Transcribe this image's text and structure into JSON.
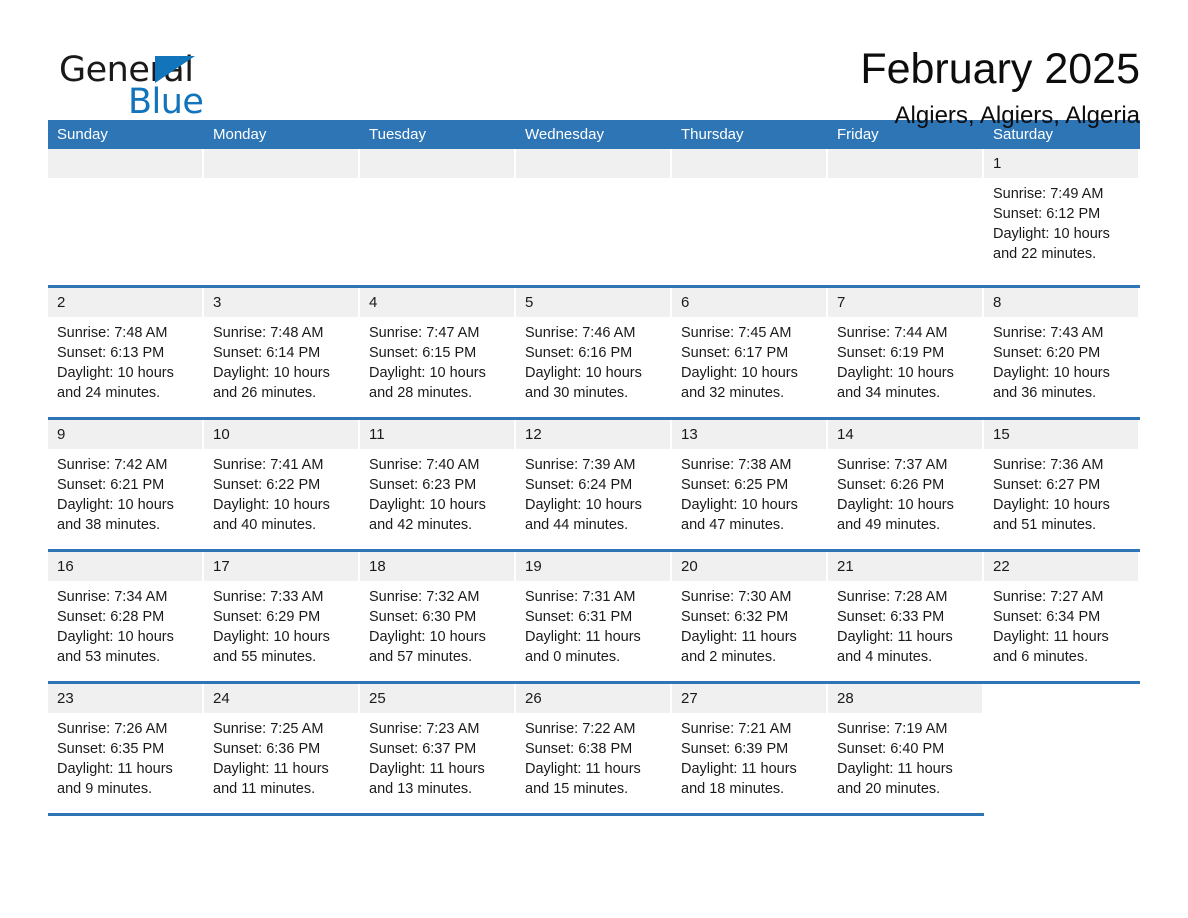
{
  "brand": {
    "name_part1": "General",
    "name_part2": "Blue",
    "triangle_color": "#1274bb",
    "accent_color": "#2e75b6"
  },
  "header": {
    "title": "February 2025",
    "location": "Algiers, Algiers, Algeria"
  },
  "calendar": {
    "weekdays": [
      "Sunday",
      "Monday",
      "Tuesday",
      "Wednesday",
      "Thursday",
      "Friday",
      "Saturday"
    ],
    "weeks": [
      [
        {
          "date": "",
          "sunrise": "",
          "sunset": "",
          "daylight_line1": "",
          "daylight_line2": ""
        },
        {
          "date": "",
          "sunrise": "",
          "sunset": "",
          "daylight_line1": "",
          "daylight_line2": ""
        },
        {
          "date": "",
          "sunrise": "",
          "sunset": "",
          "daylight_line1": "",
          "daylight_line2": ""
        },
        {
          "date": "",
          "sunrise": "",
          "sunset": "",
          "daylight_line1": "",
          "daylight_line2": ""
        },
        {
          "date": "",
          "sunrise": "",
          "sunset": "",
          "daylight_line1": "",
          "daylight_line2": ""
        },
        {
          "date": "",
          "sunrise": "",
          "sunset": "",
          "daylight_line1": "",
          "daylight_line2": ""
        },
        {
          "date": "1",
          "sunrise": "Sunrise: 7:49 AM",
          "sunset": "Sunset: 6:12 PM",
          "daylight_line1": "Daylight: 10 hours",
          "daylight_line2": "and 22 minutes."
        }
      ],
      [
        {
          "date": "2",
          "sunrise": "Sunrise: 7:48 AM",
          "sunset": "Sunset: 6:13 PM",
          "daylight_line1": "Daylight: 10 hours",
          "daylight_line2": "and 24 minutes."
        },
        {
          "date": "3",
          "sunrise": "Sunrise: 7:48 AM",
          "sunset": "Sunset: 6:14 PM",
          "daylight_line1": "Daylight: 10 hours",
          "daylight_line2": "and 26 minutes."
        },
        {
          "date": "4",
          "sunrise": "Sunrise: 7:47 AM",
          "sunset": "Sunset: 6:15 PM",
          "daylight_line1": "Daylight: 10 hours",
          "daylight_line2": "and 28 minutes."
        },
        {
          "date": "5",
          "sunrise": "Sunrise: 7:46 AM",
          "sunset": "Sunset: 6:16 PM",
          "daylight_line1": "Daylight: 10 hours",
          "daylight_line2": "and 30 minutes."
        },
        {
          "date": "6",
          "sunrise": "Sunrise: 7:45 AM",
          "sunset": "Sunset: 6:17 PM",
          "daylight_line1": "Daylight: 10 hours",
          "daylight_line2": "and 32 minutes."
        },
        {
          "date": "7",
          "sunrise": "Sunrise: 7:44 AM",
          "sunset": "Sunset: 6:19 PM",
          "daylight_line1": "Daylight: 10 hours",
          "daylight_line2": "and 34 minutes."
        },
        {
          "date": "8",
          "sunrise": "Sunrise: 7:43 AM",
          "sunset": "Sunset: 6:20 PM",
          "daylight_line1": "Daylight: 10 hours",
          "daylight_line2": "and 36 minutes."
        }
      ],
      [
        {
          "date": "9",
          "sunrise": "Sunrise: 7:42 AM",
          "sunset": "Sunset: 6:21 PM",
          "daylight_line1": "Daylight: 10 hours",
          "daylight_line2": "and 38 minutes."
        },
        {
          "date": "10",
          "sunrise": "Sunrise: 7:41 AM",
          "sunset": "Sunset: 6:22 PM",
          "daylight_line1": "Daylight: 10 hours",
          "daylight_line2": "and 40 minutes."
        },
        {
          "date": "11",
          "sunrise": "Sunrise: 7:40 AM",
          "sunset": "Sunset: 6:23 PM",
          "daylight_line1": "Daylight: 10 hours",
          "daylight_line2": "and 42 minutes."
        },
        {
          "date": "12",
          "sunrise": "Sunrise: 7:39 AM",
          "sunset": "Sunset: 6:24 PM",
          "daylight_line1": "Daylight: 10 hours",
          "daylight_line2": "and 44 minutes."
        },
        {
          "date": "13",
          "sunrise": "Sunrise: 7:38 AM",
          "sunset": "Sunset: 6:25 PM",
          "daylight_line1": "Daylight: 10 hours",
          "daylight_line2": "and 47 minutes."
        },
        {
          "date": "14",
          "sunrise": "Sunrise: 7:37 AM",
          "sunset": "Sunset: 6:26 PM",
          "daylight_line1": "Daylight: 10 hours",
          "daylight_line2": "and 49 minutes."
        },
        {
          "date": "15",
          "sunrise": "Sunrise: 7:36 AM",
          "sunset": "Sunset: 6:27 PM",
          "daylight_line1": "Daylight: 10 hours",
          "daylight_line2": "and 51 minutes."
        }
      ],
      [
        {
          "date": "16",
          "sunrise": "Sunrise: 7:34 AM",
          "sunset": "Sunset: 6:28 PM",
          "daylight_line1": "Daylight: 10 hours",
          "daylight_line2": "and 53 minutes."
        },
        {
          "date": "17",
          "sunrise": "Sunrise: 7:33 AM",
          "sunset": "Sunset: 6:29 PM",
          "daylight_line1": "Daylight: 10 hours",
          "daylight_line2": "and 55 minutes."
        },
        {
          "date": "18",
          "sunrise": "Sunrise: 7:32 AM",
          "sunset": "Sunset: 6:30 PM",
          "daylight_line1": "Daylight: 10 hours",
          "daylight_line2": "and 57 minutes."
        },
        {
          "date": "19",
          "sunrise": "Sunrise: 7:31 AM",
          "sunset": "Sunset: 6:31 PM",
          "daylight_line1": "Daylight: 11 hours",
          "daylight_line2": "and 0 minutes."
        },
        {
          "date": "20",
          "sunrise": "Sunrise: 7:30 AM",
          "sunset": "Sunset: 6:32 PM",
          "daylight_line1": "Daylight: 11 hours",
          "daylight_line2": "and 2 minutes."
        },
        {
          "date": "21",
          "sunrise": "Sunrise: 7:28 AM",
          "sunset": "Sunset: 6:33 PM",
          "daylight_line1": "Daylight: 11 hours",
          "daylight_line2": "and 4 minutes."
        },
        {
          "date": "22",
          "sunrise": "Sunrise: 7:27 AM",
          "sunset": "Sunset: 6:34 PM",
          "daylight_line1": "Daylight: 11 hours",
          "daylight_line2": "and 6 minutes."
        }
      ],
      [
        {
          "date": "23",
          "sunrise": "Sunrise: 7:26 AM",
          "sunset": "Sunset: 6:35 PM",
          "daylight_line1": "Daylight: 11 hours",
          "daylight_line2": "and 9 minutes."
        },
        {
          "date": "24",
          "sunrise": "Sunrise: 7:25 AM",
          "sunset": "Sunset: 6:36 PM",
          "daylight_line1": "Daylight: 11 hours",
          "daylight_line2": "and 11 minutes."
        },
        {
          "date": "25",
          "sunrise": "Sunrise: 7:23 AM",
          "sunset": "Sunset: 6:37 PM",
          "daylight_line1": "Daylight: 11 hours",
          "daylight_line2": "and 13 minutes."
        },
        {
          "date": "26",
          "sunrise": "Sunrise: 7:22 AM",
          "sunset": "Sunset: 6:38 PM",
          "daylight_line1": "Daylight: 11 hours",
          "daylight_line2": "and 15 minutes."
        },
        {
          "date": "27",
          "sunrise": "Sunrise: 7:21 AM",
          "sunset": "Sunset: 6:39 PM",
          "daylight_line1": "Daylight: 11 hours",
          "daylight_line2": "and 18 minutes."
        },
        {
          "date": "28",
          "sunrise": "Sunrise: 7:19 AM",
          "sunset": "Sunset: 6:40 PM",
          "daylight_line1": "Daylight: 11 hours",
          "daylight_line2": "and 20 minutes."
        },
        {
          "date": "",
          "sunrise": "",
          "sunset": "",
          "daylight_line1": "",
          "daylight_line2": ""
        }
      ]
    ]
  }
}
